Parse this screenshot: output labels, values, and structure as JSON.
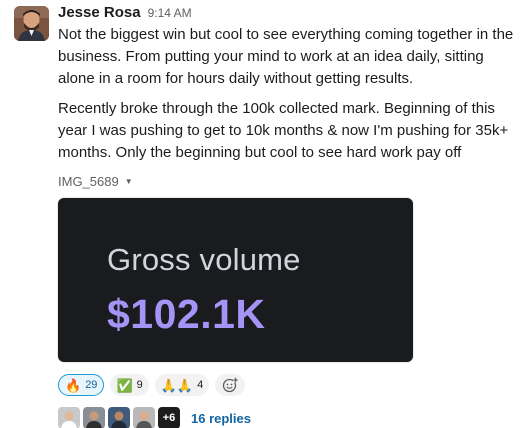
{
  "message": {
    "author": "Jesse Rosa",
    "time": "9:14 AM",
    "paragraph_1": "Not the biggest win but cool to see everything coming together in the business. From putting your mind to work at an idea daily, sitting alone in a room for hours daily without getting results.",
    "paragraph_2": "Recently broke through the 100k collected mark. Beginning of this year I was pushing to get to 10k months & now I'm pushing for 35k+ months. Only the beginning but cool to see hard work pay off"
  },
  "attachment": {
    "file_name": "IMG_5689",
    "caret_icon": "caret-down-icon",
    "image_label": "Gross volume",
    "image_value": "$102.1K",
    "colors": {
      "background": "#1a1b1f",
      "label": "#d4d5dc",
      "value": "#a594f5"
    }
  },
  "reactions": [
    {
      "emoji": "fire",
      "glyph": "🔥",
      "count": "29",
      "active": true
    },
    {
      "emoji": "white-check-mark",
      "glyph": "✅",
      "count": "9",
      "active": false
    },
    {
      "emoji": "pray",
      "glyph": "🙏🙏",
      "count": "4",
      "active": false
    }
  ],
  "add_reaction_icon": "add-emoji-icon",
  "thread": {
    "more_count": "+6",
    "replies_label": "16 replies"
  },
  "colors": {
    "link": "#1264a3",
    "active_reaction_border": "#1d9bd1",
    "active_reaction_bg": "#e8f5fa"
  }
}
